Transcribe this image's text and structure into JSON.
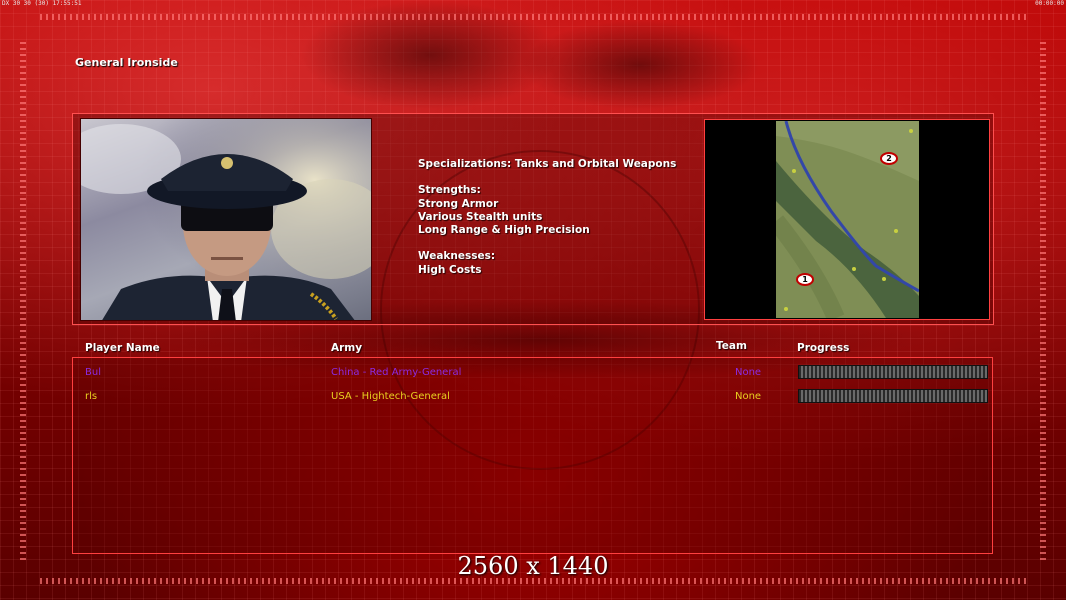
{
  "status_bar": {
    "left": "DX 30 30 (30) 17:55:51",
    "right": "00:00:00"
  },
  "general": {
    "title": "General Ironside",
    "specialization": "Specializations: Tanks and Orbital Weapons",
    "strengths_header": "Strengths:",
    "strengths": [
      "Strong Armor",
      "Various Stealth units",
      "Long Range & High Precision"
    ],
    "weaknesses_header": "Weaknesses:",
    "weaknesses": [
      "High Costs"
    ]
  },
  "minimap": {
    "markers": [
      "1",
      "2"
    ]
  },
  "table": {
    "headers": {
      "player": "Player Name",
      "army": "Army",
      "team": "Team",
      "progress": "Progress"
    },
    "rows": [
      {
        "player": "Bul",
        "army": "China - Red Army-General",
        "team": "None",
        "color": "#8a2be2",
        "progress": 0
      },
      {
        "player": "rls",
        "army": "USA - Hightech-General",
        "team": "None",
        "color": "#e8d020",
        "progress": 0
      }
    ]
  },
  "overlay": {
    "resolution": "2560 x 1440"
  },
  "colors": {
    "accent": "#ff4040",
    "background": "#8a0000"
  }
}
